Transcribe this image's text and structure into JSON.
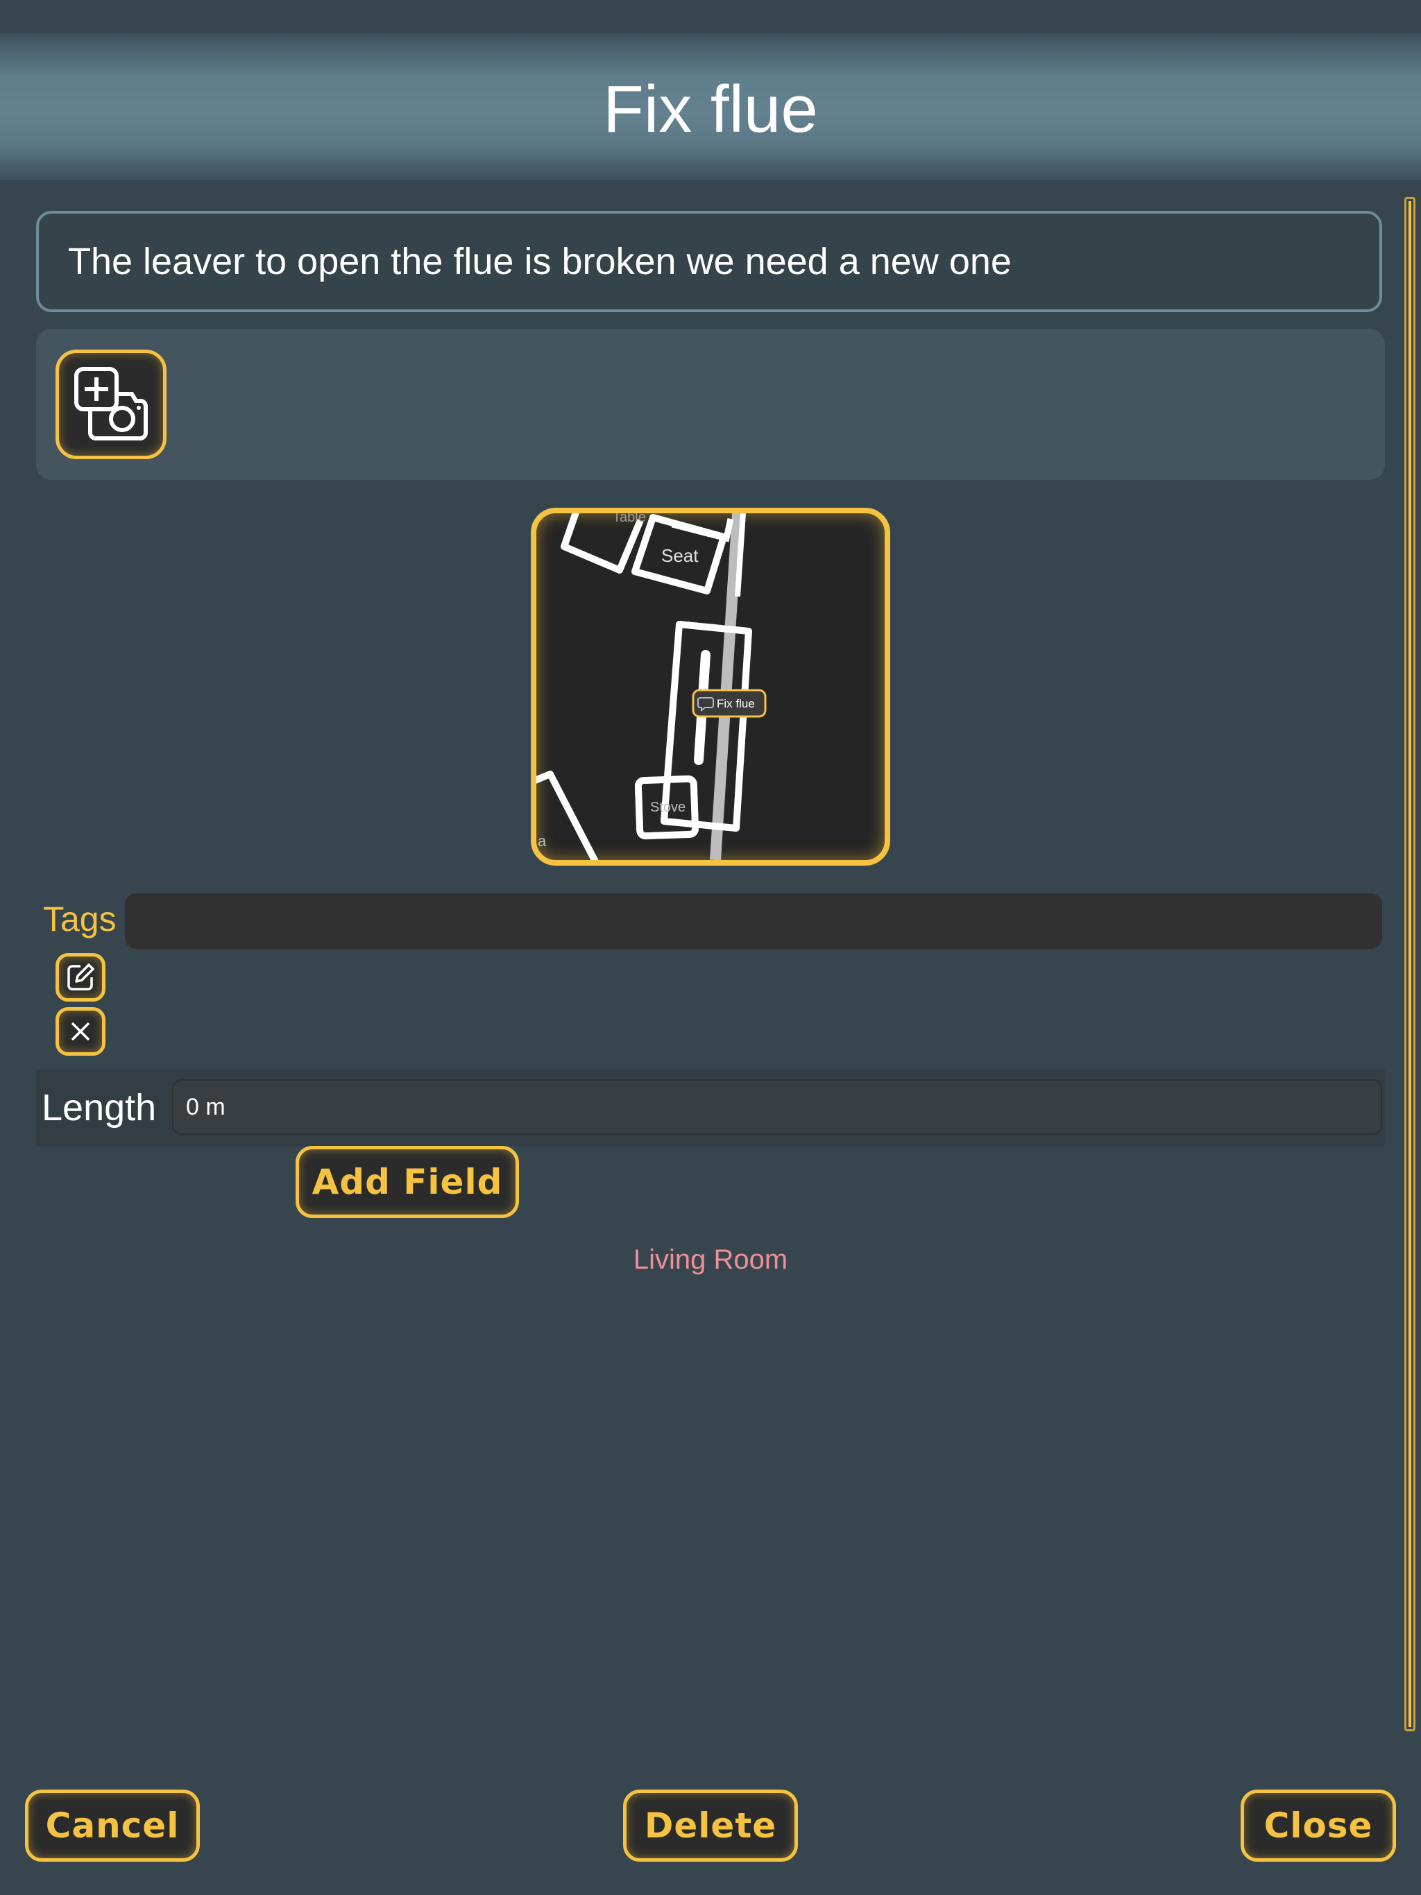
{
  "header": {
    "title": "Fix flue"
  },
  "description": {
    "value": "The leaver to open the flue is broken we need a new one"
  },
  "photos": {
    "add_photo_icon": "add-photo-icon"
  },
  "map": {
    "labels": {
      "table": "Table",
      "seat": "Seat",
      "stove": "Stove",
      "edge": "a"
    },
    "marker_label": "Fix flue"
  },
  "tags": {
    "label": "Tags",
    "edit_icon": "pencil-icon",
    "clear_icon": "close-icon"
  },
  "fields": {
    "length": {
      "label": "Length",
      "value": "0 m"
    },
    "add_field_label": "Add Field"
  },
  "location": {
    "room": "Living Room"
  },
  "footer": {
    "cancel_label": "Cancel",
    "delete_label": "Delete",
    "close_label": "Close"
  },
  "colors": {
    "accent": "#f5c242",
    "background": "#36454e",
    "room_text": "#f08f96"
  }
}
